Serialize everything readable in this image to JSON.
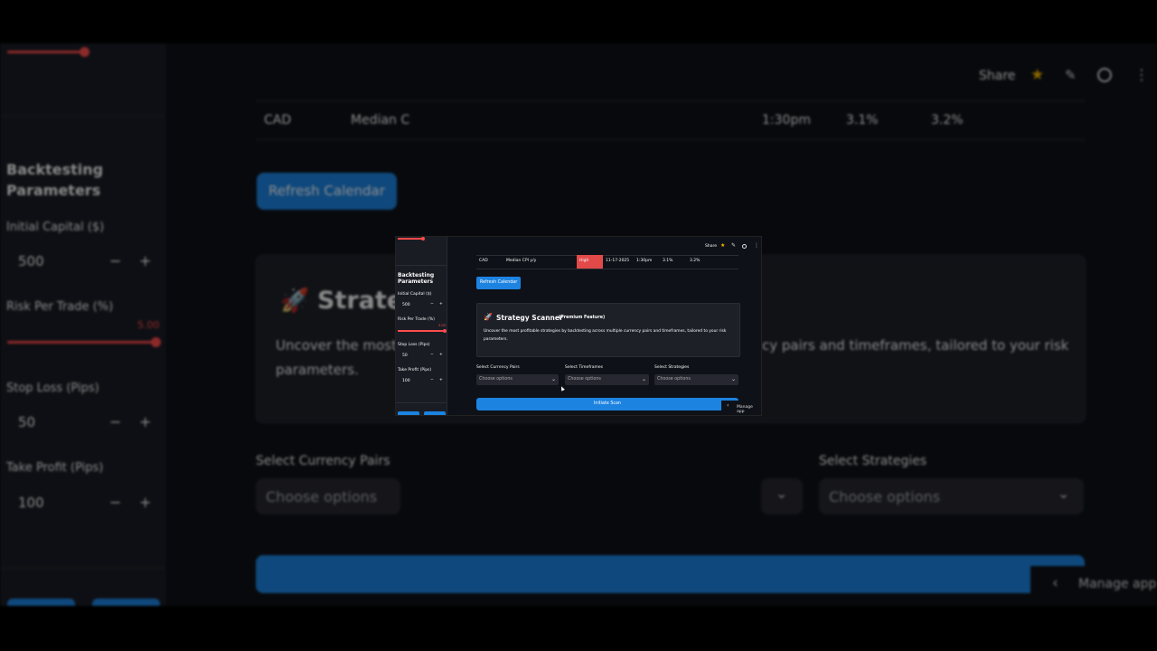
{
  "header": {
    "share_label": "Share",
    "star_icon": "star-icon",
    "edit_icon": "pencil-icon",
    "github_icon": "github-icon",
    "menu_icon": "kebab-menu-icon"
  },
  "sidebar": {
    "heading": "Backtesting Parameters",
    "risk_fraction": 1.0,
    "fields": {
      "initial_capital": {
        "label": "Initial Capital ($)",
        "value": "500"
      },
      "risk_per_trade": {
        "label": "Risk Per Trade (%)",
        "value": "5.00"
      },
      "stop_loss": {
        "label": "Stop Loss (Pips)",
        "value": "50"
      },
      "take_profit": {
        "label": "Take Profit (Pips)",
        "value": "100"
      }
    },
    "minus": "−",
    "plus": "+"
  },
  "calendar_row": {
    "currency": "CAD",
    "event": "Median CPI y/y",
    "impact": "High",
    "date": "11-17-2025",
    "time": "1:30pm",
    "actual": "3.1%",
    "forecast": "3.2%",
    "impact_color": "#e24a4a"
  },
  "bg_calendar_row": {
    "currency": "CAD",
    "event": "Median C",
    "time": "1:30pm",
    "actual": "3.1%",
    "forecast": "3.2%"
  },
  "refresh_button": "Refresh Calendar",
  "scanner": {
    "title": "Strategy Scanner",
    "badge": "(Premium Feature)",
    "bg_title": "Strateg",
    "description": "Uncover the most profitable strategies by backtesting across multiple currency pairs and timeframes, tailored to your risk parameters.",
    "bg_desc_left": "Uncover the most p",
    "bg_desc_left2": "parameters.",
    "bg_desc_right": "cy pairs and timeframes, tailored to your risk",
    "rocket_icon": "rocket-icon"
  },
  "selects": {
    "currency_pairs": {
      "label": "Select Currency Pairs",
      "placeholder": "Choose options"
    },
    "timeframes": {
      "label": "Select Timeframes",
      "placeholder": "Choose options"
    },
    "strategies": {
      "label": "Select Strategies",
      "placeholder": "Choose options"
    }
  },
  "scan_button": "Initiate Scan",
  "manage_app": "Manage app",
  "colors": {
    "accent_blue": "#1c83e1",
    "slider_red": "#ff4b4b",
    "bg": "#0e1117",
    "sidebar": "#1a1c24"
  }
}
